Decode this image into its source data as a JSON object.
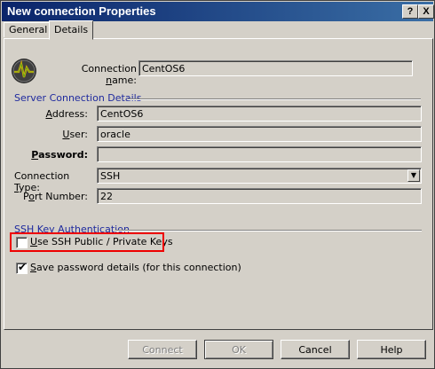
{
  "window": {
    "title": "New connection Properties",
    "help_button": "?",
    "close_button": "X"
  },
  "tabs": [
    {
      "label": "General",
      "selected": false
    },
    {
      "label": "Details",
      "selected": true
    }
  ],
  "connection": {
    "label_pre": "Connection ",
    "label_u": "n",
    "label_post": "ame:",
    "value": "CentOS6"
  },
  "server_group": {
    "title": "Server Connection Details",
    "address_u": "A",
    "address_rest": "ddress:",
    "address_value": "CentOS6",
    "user_u": "U",
    "user_rest": "ser:",
    "user_value": "oracle",
    "password_u": "P",
    "password_rest": "assword:",
    "password_value": "",
    "conn_type_pre": "Connection ",
    "conn_type_u": "T",
    "conn_type_post": "ype:",
    "conn_type_value": "SSH",
    "port_pre": "P",
    "port_u": "o",
    "port_post": "rt Number:",
    "port_value": "22"
  },
  "ssh_group": {
    "title": "SSH Key Authentication",
    "use_keys_u": "U",
    "use_keys_rest": "se SSH Public / Private Keys",
    "use_keys_checked": false
  },
  "save_password": {
    "u": "S",
    "rest": "ave password details (for this connection)",
    "checked": true,
    "check_glyph": "✔"
  },
  "buttons": {
    "connect": "Connect",
    "ok": "OK",
    "cancel": "Cancel",
    "help": "Help"
  },
  "colors": {
    "title_bar": "#0a246a",
    "group_title": "#1f2a9e",
    "highlight": "#ee0000"
  }
}
